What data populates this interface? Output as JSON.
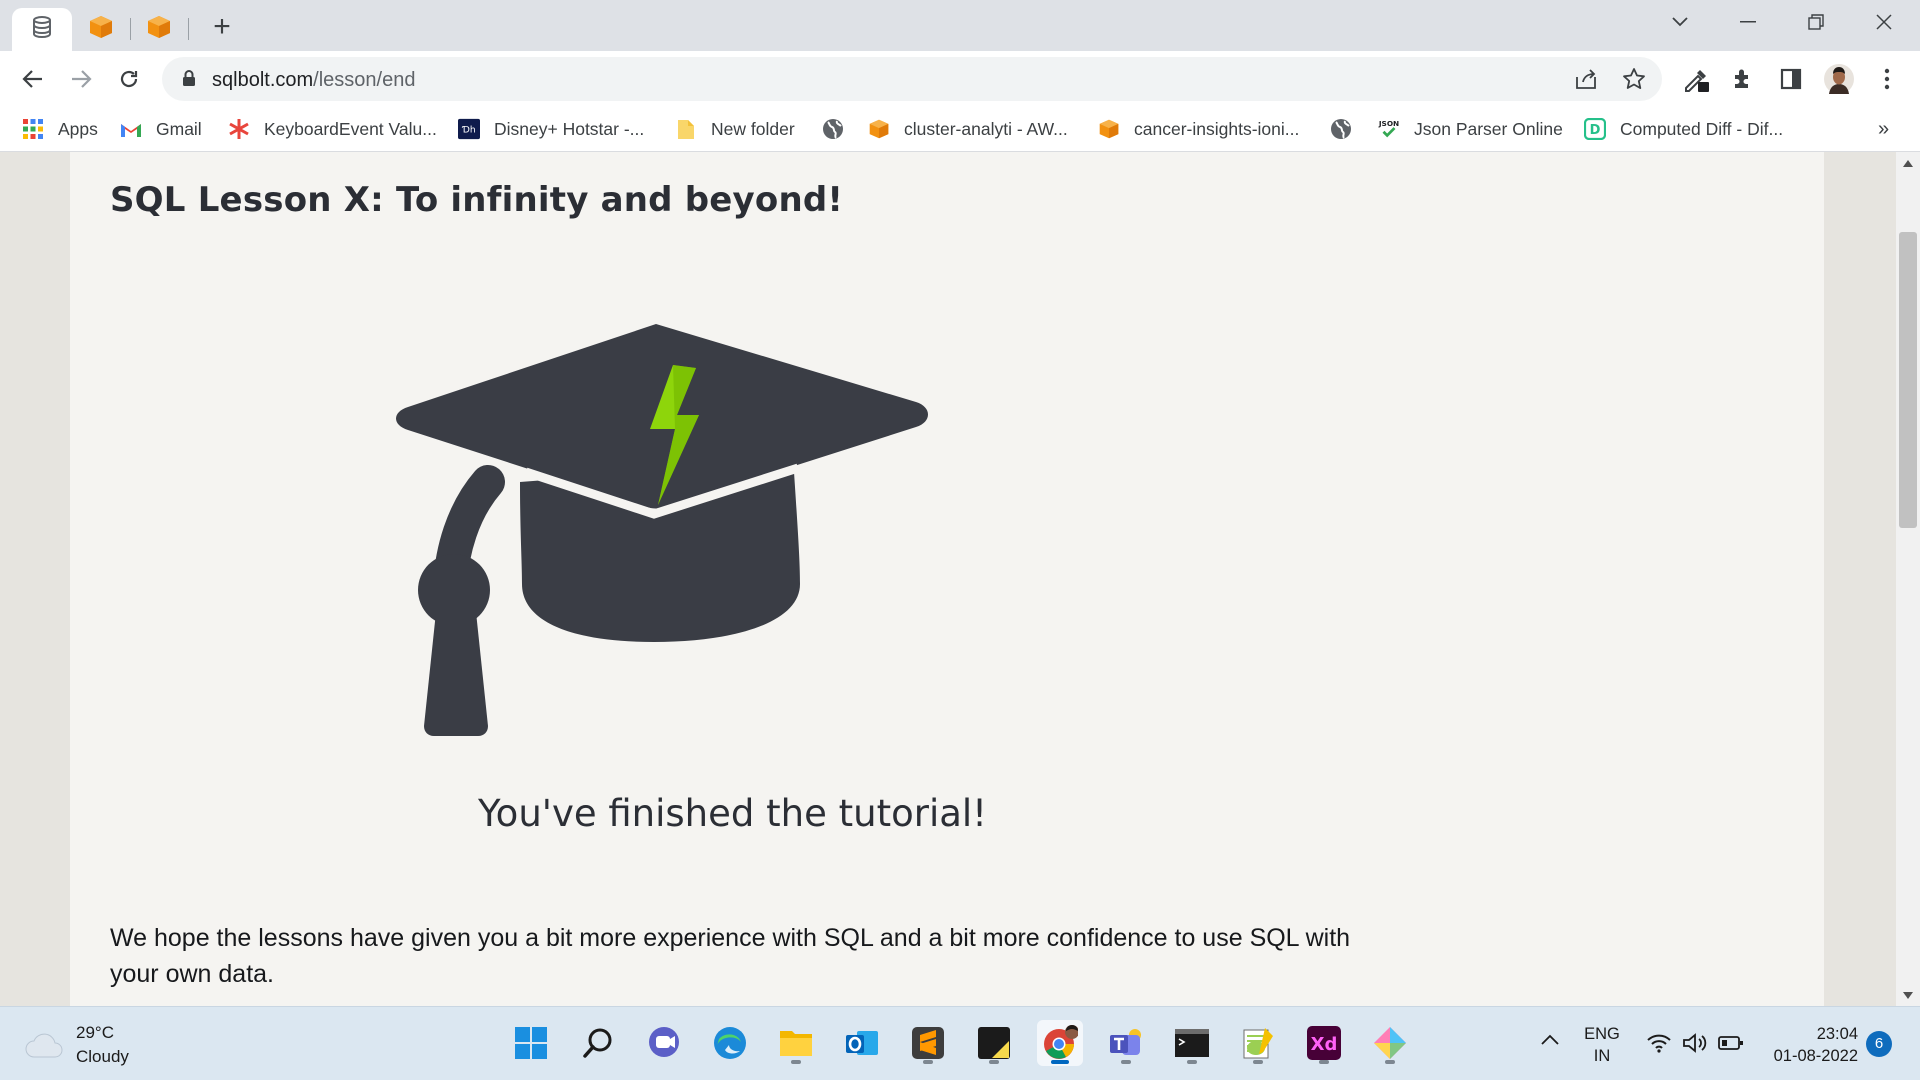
{
  "browser": {
    "tabs": [
      {
        "icon": "database-icon",
        "active": true
      },
      {
        "icon": "orange-box-icon",
        "active": false
      },
      {
        "icon": "orange-box-icon",
        "active": false
      }
    ],
    "new_tab_label": "+",
    "url_host": "sqlbolt.com",
    "url_path": "/lesson/end"
  },
  "bookmarks": [
    {
      "label": "Apps",
      "icon": "apps-grid-icon"
    },
    {
      "label": "Gmail",
      "icon": "gmail-icon"
    },
    {
      "label": "KeyboardEvent Valu...",
      "icon": "asterisk-icon"
    },
    {
      "label": "Disney+ Hotstar -...",
      "icon": "hotstar-icon"
    },
    {
      "label": "New folder",
      "icon": "folder-icon"
    },
    {
      "label": "",
      "icon": "globe-icon"
    },
    {
      "label": "cluster-analyti - AW...",
      "icon": "aws-box-icon"
    },
    {
      "label": "cancer-insights-ioni...",
      "icon": "aws-box-icon"
    },
    {
      "label": "",
      "icon": "globe-icon"
    },
    {
      "label": "Json Parser Online",
      "icon": "json-icon"
    },
    {
      "label": "Computed Diff - Dif...",
      "icon": "diff-icon"
    }
  ],
  "bookmarks_overflow": "»",
  "page": {
    "title": "SQL Lesson X: To infinity and beyond!",
    "finished_text": "You've finished the tutorial!",
    "paragraph": "We hope the lessons have given you a bit more experience with SQL and a bit more confidence to use SQL with your own data."
  },
  "taskbar": {
    "weather_temp": "29°C",
    "weather_desc": "Cloudy",
    "lang_line1": "ENG",
    "lang_line2": "IN",
    "time": "23:04",
    "date": "01-08-2022",
    "notification_count": "6"
  },
  "colors": {
    "cap": "#3a3d45",
    "bolt": "#8ed50b",
    "page_bg": "#f5f4f1",
    "taskbar": "#dbe7f1"
  }
}
